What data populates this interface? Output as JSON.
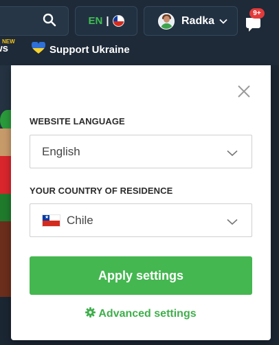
{
  "header": {
    "language_code": "EN",
    "language_separator": "|",
    "user_name": "Radka",
    "notification_count": "9+",
    "nav_news_tag": "NEW",
    "nav_news_label": "ws",
    "nav_ukraine_label": "Support Ukraine"
  },
  "settings_panel": {
    "language_label": "WEBSITE LANGUAGE",
    "language_value": "English",
    "country_label": "YOUR COUNTRY OF RESIDENCE",
    "country_value": "Chile",
    "apply_label": "Apply settings",
    "advanced_label": "Advanced settings"
  },
  "colors": {
    "accent_green": "#44b750",
    "header_bg": "#1e2a38",
    "badge_red": "#e23b3b"
  },
  "icons": [
    "search-icon",
    "chile-flag-icon",
    "avatar",
    "chevron-down-icon",
    "notification-icon",
    "ukraine-heart-icon",
    "close-icon",
    "gear-icon"
  ]
}
